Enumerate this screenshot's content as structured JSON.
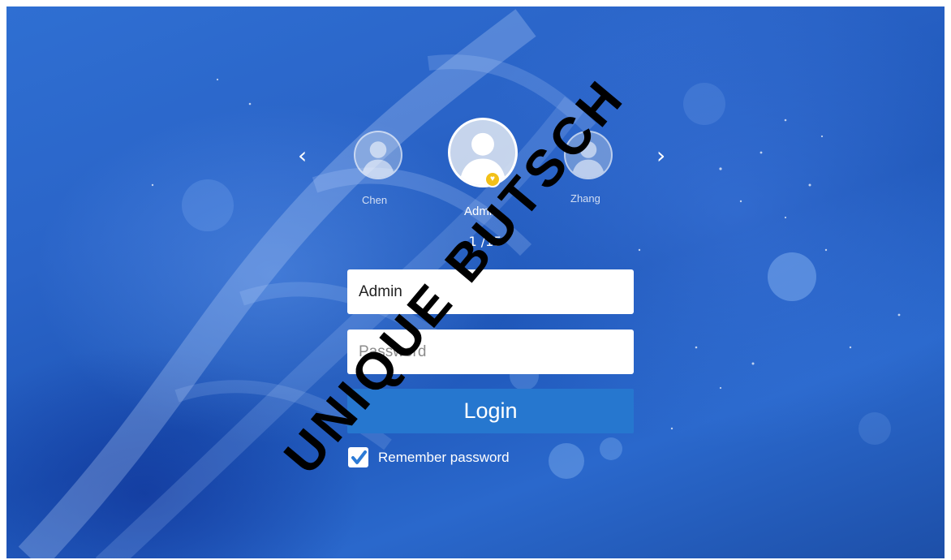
{
  "carousel": {
    "prev_icon": "chevron-left-icon",
    "next_icon": "chevron-right-icon",
    "prev_glyph": "‹",
    "next_glyph": "›",
    "users": [
      {
        "name": "Chen",
        "selected": false
      },
      {
        "name": "Admin",
        "selected": true,
        "badge_icon": "crown-badge-icon",
        "badge_color": "#f2c018"
      },
      {
        "name": "Zhang",
        "selected": false
      }
    ],
    "counter": "1 /15"
  },
  "form": {
    "username_value": "Admin",
    "password_placeholder": "Password",
    "login_label": "Login",
    "remember_checked": true,
    "remember_label": "Remember password"
  },
  "watermark": {
    "text": "UNIQUE BUTSCH",
    "color": "#000000"
  },
  "colors": {
    "background": "#2a64c8",
    "button": "#2677cf",
    "checkbox_mark": "#2b7ad6"
  }
}
